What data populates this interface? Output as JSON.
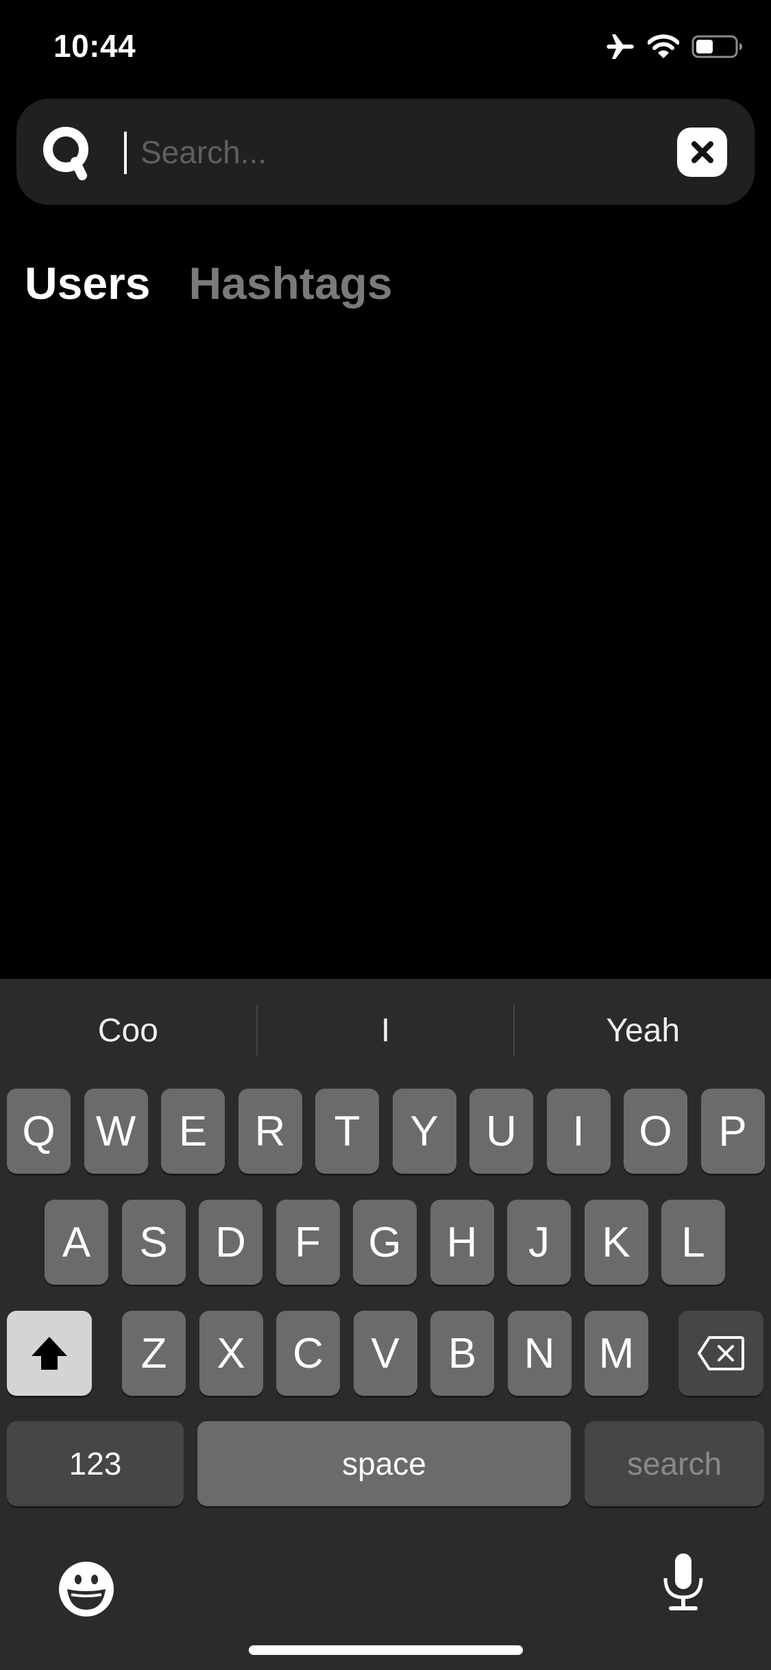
{
  "status_bar": {
    "time": "10:44",
    "icons": [
      "airplane-icon",
      "wifi-icon",
      "battery-icon"
    ],
    "battery_level": 0.4
  },
  "search": {
    "placeholder": "Search...",
    "value": "",
    "search_icon": "search-icon",
    "clear_icon": "close-icon"
  },
  "tabs": [
    {
      "label": "Users",
      "active": true
    },
    {
      "label": "Hashtags",
      "active": false
    }
  ],
  "keyboard": {
    "suggestions": [
      "Coo",
      "I",
      "Yeah"
    ],
    "row1": [
      "Q",
      "W",
      "E",
      "R",
      "T",
      "Y",
      "U",
      "I",
      "O",
      "P"
    ],
    "row2": [
      "A",
      "S",
      "D",
      "F",
      "G",
      "H",
      "J",
      "K",
      "L"
    ],
    "row3": [
      "Z",
      "X",
      "C",
      "V",
      "B",
      "N",
      "M"
    ],
    "shift_icon": "shift-arrow-icon",
    "delete_icon": "backspace-icon",
    "numbers_label": "123",
    "space_label": "space",
    "return_label": "search",
    "emoji_icon": "emoji-icon",
    "mic_icon": "microphone-icon"
  },
  "colors": {
    "background": "#000000",
    "search_bar": "#202020",
    "tab_active": "#ffffff",
    "tab_inactive": "#7a7a7a",
    "keyboard_bg": "#2b2b2b",
    "key": "#6b6b6b",
    "key_dark": "#464646"
  }
}
